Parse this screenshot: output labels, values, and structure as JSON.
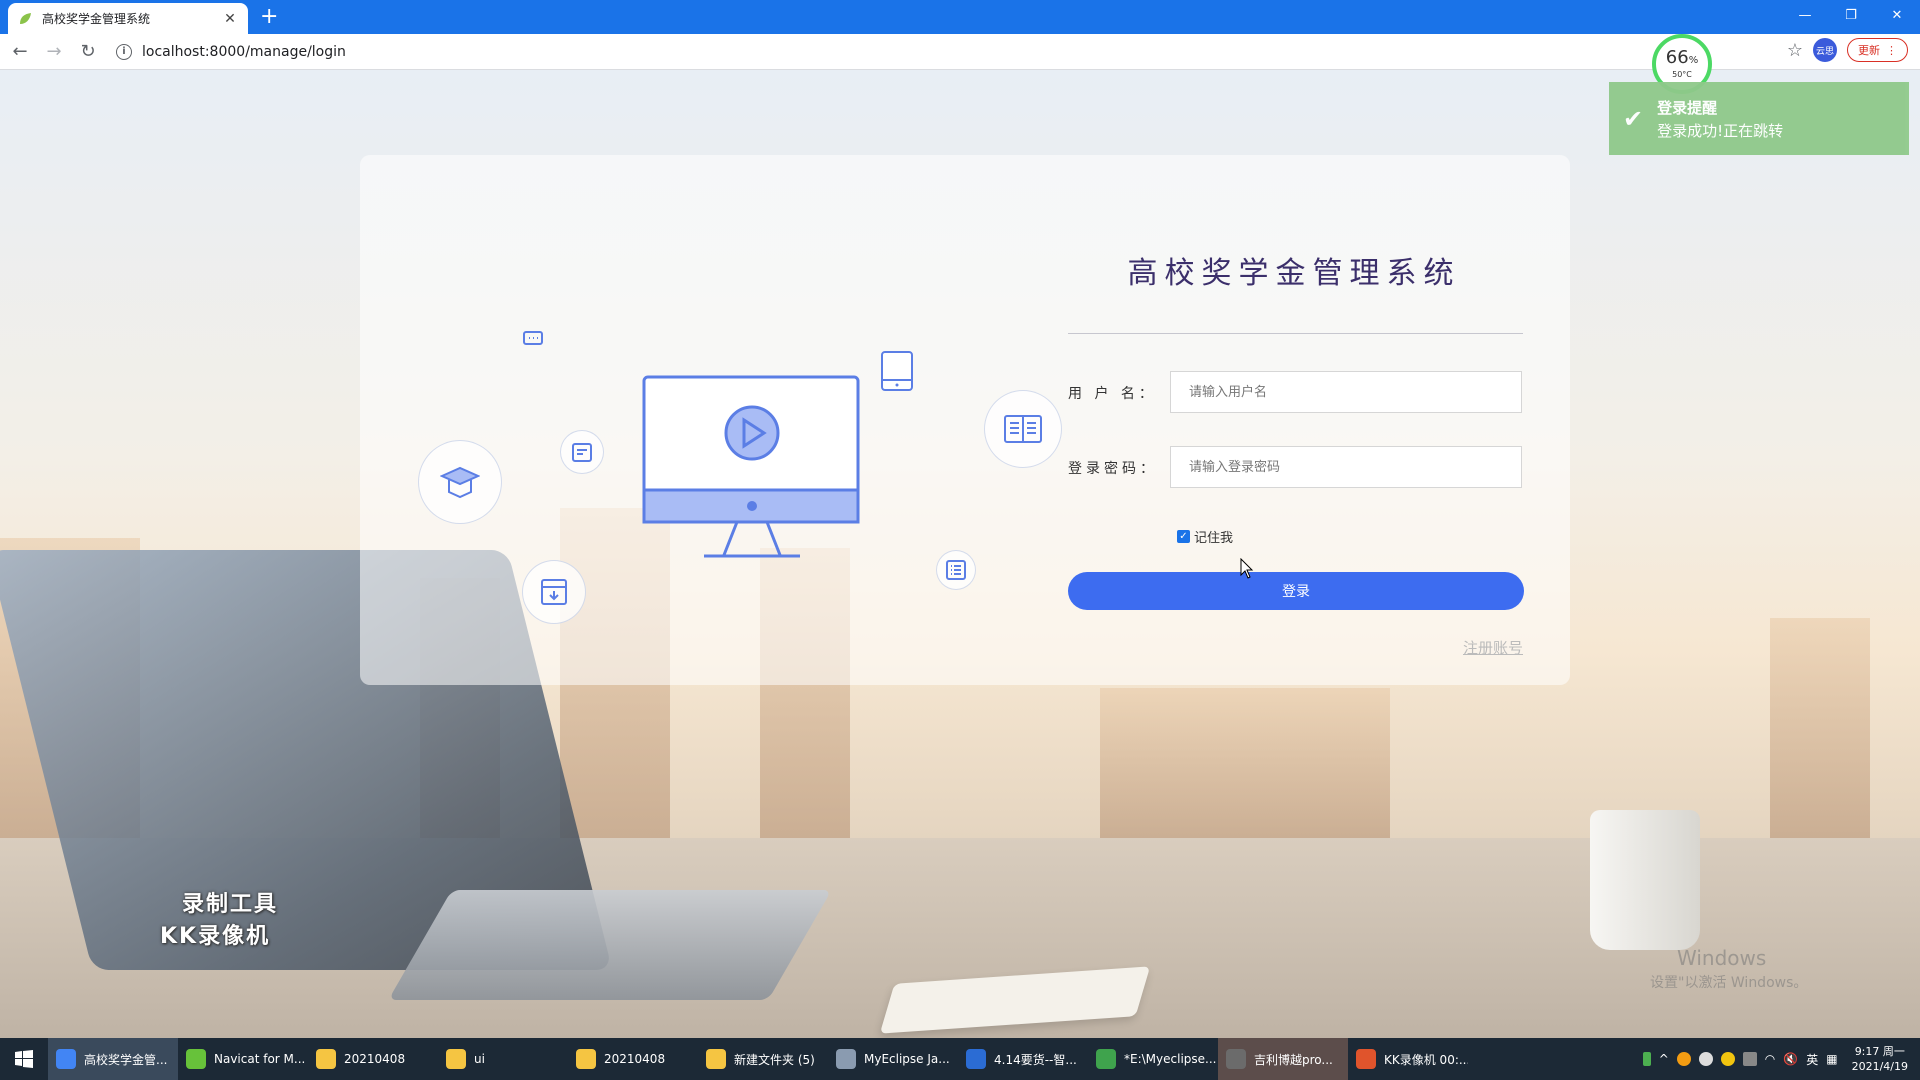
{
  "browser": {
    "tab_title": "高校奖学金管理系统",
    "new_tab": "+",
    "url": "localhost:8000/manage/login",
    "profile_label": "云思",
    "update_label": "更新"
  },
  "perf_widget": {
    "percent": "66",
    "percent_unit": "%",
    "temp": "50°C"
  },
  "toast": {
    "title": "登录提醒",
    "message": "登录成功!正在跳转"
  },
  "login": {
    "title": "高校奖学金管理系统",
    "username_label": "用 户 名：",
    "username_placeholder": "请输入用户名",
    "password_label": "登录密码：",
    "password_placeholder": "请输入登录密码",
    "remember_label": "记住我",
    "remember_checked": true,
    "submit_label": "登录",
    "register_link": "注册账号"
  },
  "watermarks": {
    "recorder_line1": "录制工具",
    "recorder_line2": "KK录像机",
    "activate_title": "Windows",
    "activate_msg": "设置\"以激活 Windows。"
  },
  "taskbar": {
    "items": [
      {
        "label": "高校奖学金管...",
        "color": "#4285f4"
      },
      {
        "label": "Navicat for M...",
        "color": "#67c23a"
      },
      {
        "label": "20210408",
        "color": "#f5c542"
      },
      {
        "label": "ui",
        "color": "#f5c542"
      },
      {
        "label": "20210408",
        "color": "#f5c542"
      },
      {
        "label": "新建文件夹 (5)",
        "color": "#f5c542"
      },
      {
        "label": "MyEclipse Ja...",
        "color": "#8a9bb0"
      },
      {
        "label": "4.14要货--智...",
        "color": "#2b6cd4"
      },
      {
        "label": "*E:\\Myeclipse...",
        "color": "#3fa34d"
      },
      {
        "label": "吉利博越pro...",
        "color": "#6b6b6b"
      },
      {
        "label": "KK录像机 00:...",
        "color": "#e0542c"
      }
    ],
    "tray_lang": "英",
    "time": "9:17 周一",
    "date": "2021/4/19"
  }
}
